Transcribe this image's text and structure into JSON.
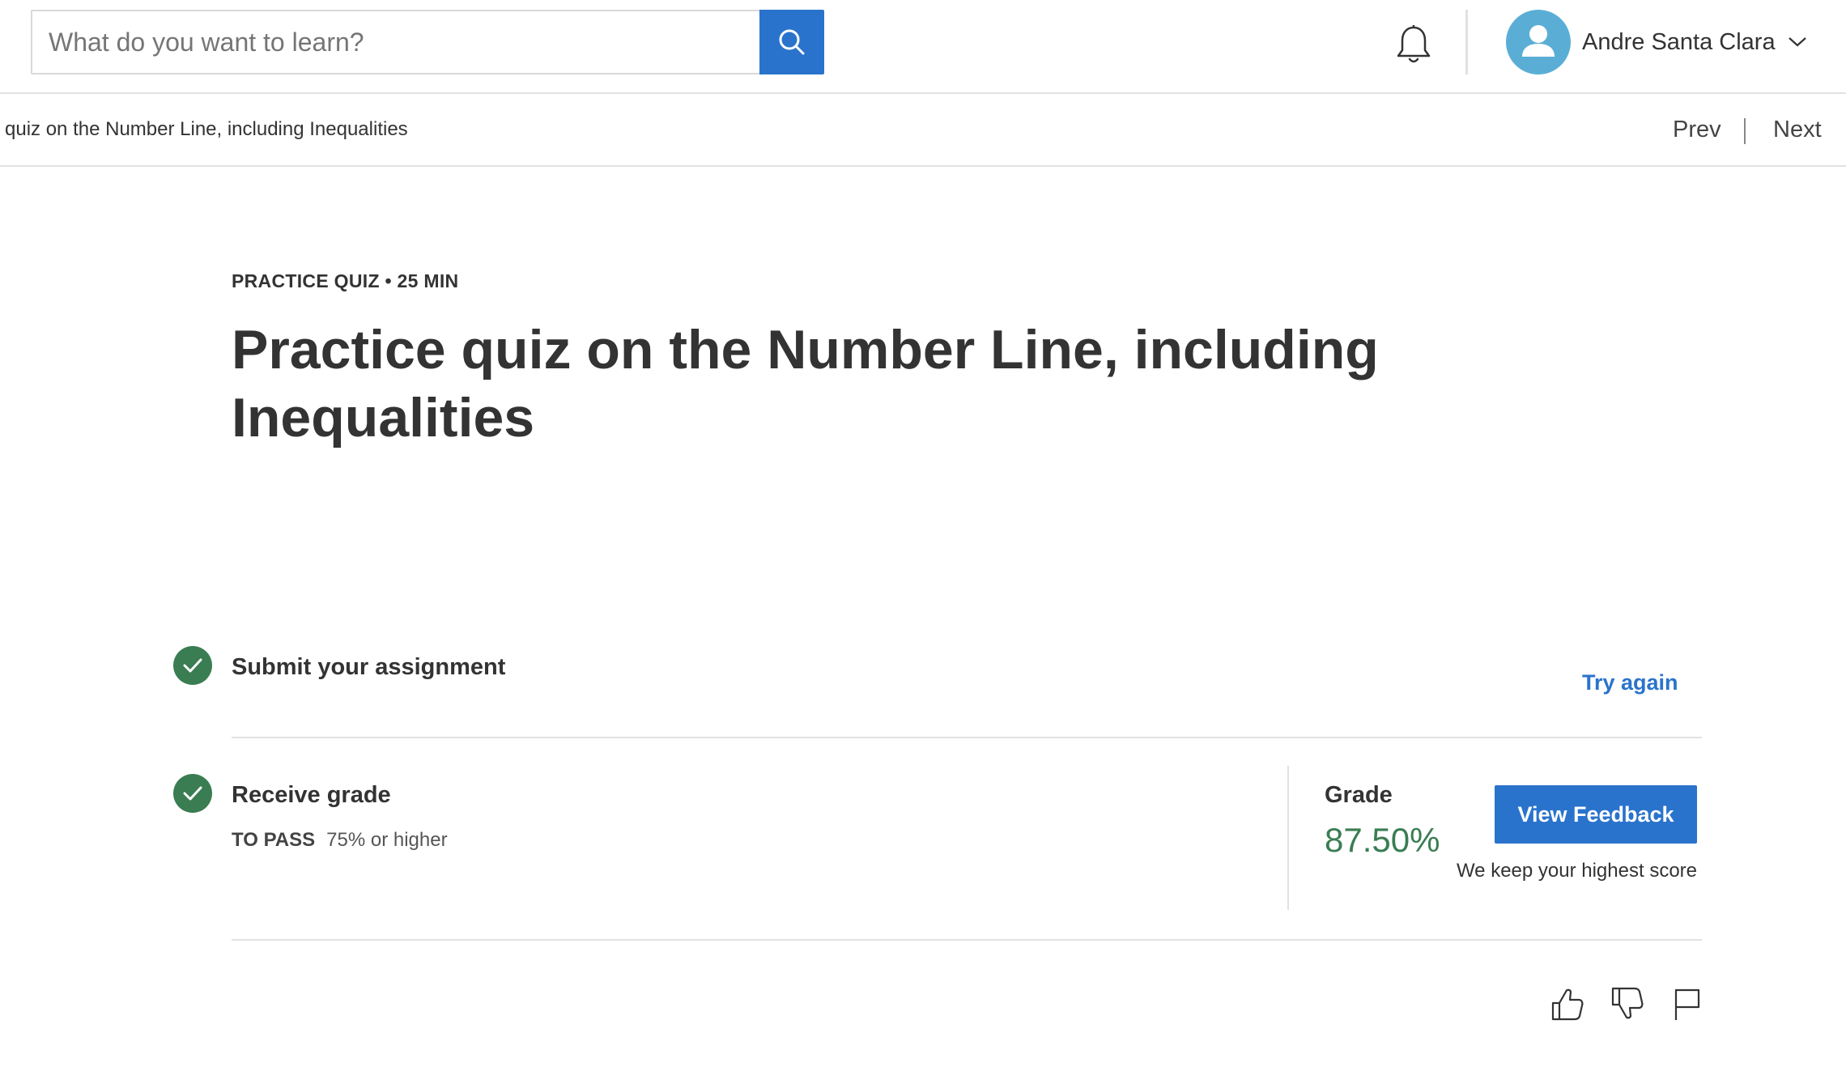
{
  "header": {
    "search_placeholder": "What do you want to learn?",
    "user_name": "Andre Santa Clara",
    "icons": {
      "search": "search-icon",
      "notifications": "bell-icon",
      "avatar": "user-avatar-icon",
      "menu": "chevron-down-icon"
    }
  },
  "subnav": {
    "breadcrumb": "e quiz on the Number Line, including Inequalities",
    "prev_label": "Prev",
    "next_label": "Next"
  },
  "quiz": {
    "meta": "PRACTICE QUIZ • 25 MIN",
    "title": "Practice quiz on the Number Line, including Inequalities"
  },
  "steps": {
    "submit": {
      "title": "Submit your assignment",
      "action_label": "Try again"
    },
    "receive": {
      "title": "Receive grade",
      "pass_label": "TO PASS",
      "pass_value": "75% or higher"
    }
  },
  "grade": {
    "label": "Grade",
    "value": "87.50%",
    "button_label": "View Feedback",
    "note": "We keep your highest score"
  },
  "feedback": {
    "icons": [
      "thumbs-up-icon",
      "thumbs-down-icon",
      "flag-icon"
    ]
  },
  "colors": {
    "accent": "#2a73cc",
    "success": "#3a7d52",
    "avatar_bg": "#5aaed6",
    "text": "#333333",
    "divider": "#e1e1e1"
  }
}
